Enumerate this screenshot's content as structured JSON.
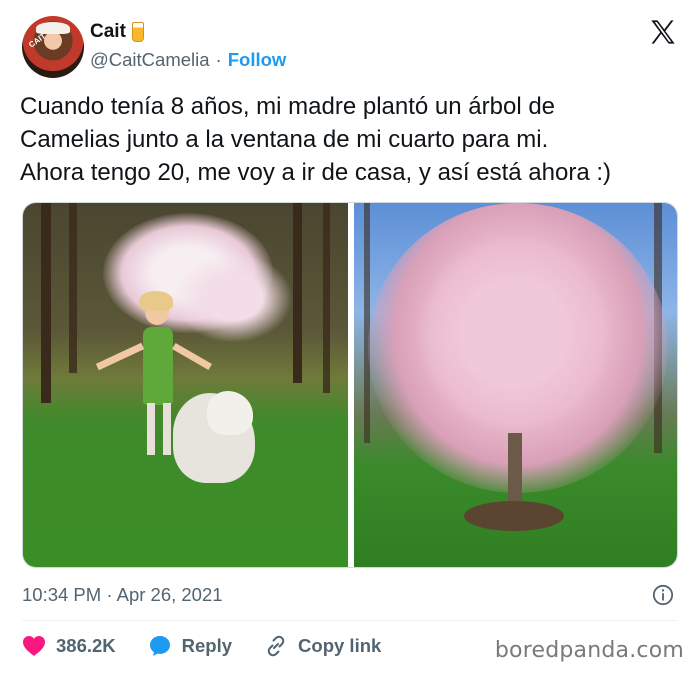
{
  "author": {
    "display_name": "Cait",
    "name_emoji_icon": "juice-box-icon",
    "handle": "@CaitCamelia",
    "separator": "·",
    "follow_label": "Follow",
    "avatar_label": "CAIT"
  },
  "brand": {
    "logo_icon": "x-logo-icon"
  },
  "tweet": {
    "lines": [
      "Cuando tenía 8 años, mi madre plantó un árbol de",
      "Camelias junto a la ventana de mi cuarto para mi.",
      "Ahora tengo 20, me voy a ir de casa, y así está ahora :)"
    ]
  },
  "meta": {
    "timestamp": "10:34 PM · Apr 26, 2021"
  },
  "actions": {
    "like_count": "386.2K",
    "reply_label": "Reply",
    "copy_link_label": "Copy link"
  },
  "watermark": "boredpanda.com",
  "colors": {
    "accent": "#1d9bf0",
    "like": "#f91880",
    "muted": "#536471",
    "text": "#0f1419"
  }
}
